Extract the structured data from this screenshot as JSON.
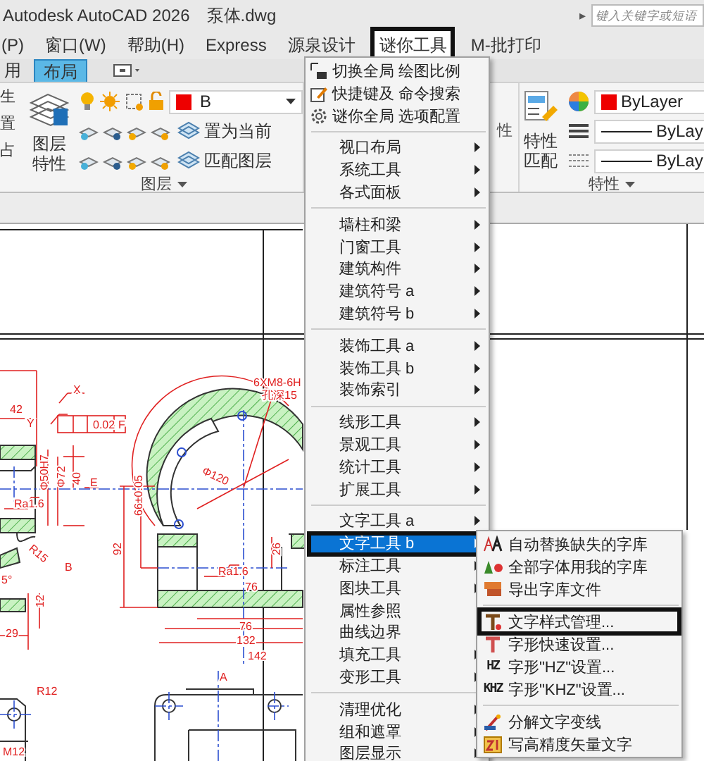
{
  "title_bar": {
    "app": "Autodesk AutoCAD 2026",
    "file": "泵体.dwg",
    "search": {
      "arrow": "▸",
      "placeholder": "键入关键字或短语"
    }
  },
  "menu_bar": [
    {
      "label": "(P)",
      "selected": false,
      "boxed": false
    },
    {
      "label": "窗口(W)",
      "selected": false,
      "boxed": false
    },
    {
      "label": "帮助(H)",
      "selected": false,
      "boxed": false
    },
    {
      "label": "Express",
      "selected": false,
      "boxed": false
    },
    {
      "label": "源泉设计",
      "selected": false,
      "boxed": false
    },
    {
      "label": "谜你工具",
      "selected": true,
      "boxed": true
    },
    {
      "label": "M-批打印",
      "selected": false,
      "boxed": false
    }
  ],
  "tabs": [
    {
      "label": "用",
      "selected": false
    },
    {
      "label": "布局",
      "selected": true
    }
  ],
  "ribbon": {
    "left_column": [
      "生",
      "置",
      "占"
    ],
    "layer_panel": {
      "big_button": "图层特性",
      "layer_name": "B",
      "buttons": [
        "置为当前",
        "匹配图层"
      ],
      "title": "图层"
    },
    "hidden_panel_label": "性",
    "properties_panel": {
      "match_button": "特性匹配",
      "color_setting": "ByLayer",
      "lineweight": "ByLay",
      "linetype": "ByLay",
      "title": "特性"
    }
  },
  "menu": {
    "groups": [
      [
        {
          "label": "切换全局 绘图比例",
          "submenu": false,
          "selected": false,
          "boxed": false
        },
        {
          "label": "快捷键及 命令搜索",
          "submenu": false,
          "selected": false,
          "boxed": false
        },
        {
          "label": "谜你全局 选项配置",
          "submenu": false,
          "selected": false,
          "boxed": false
        }
      ],
      [
        {
          "label": "视口布局",
          "submenu": true,
          "selected": false,
          "boxed": false
        },
        {
          "label": "系统工具",
          "submenu": true,
          "selected": false,
          "boxed": false
        },
        {
          "label": "各式面板",
          "submenu": true,
          "selected": false,
          "boxed": false
        }
      ],
      [
        {
          "label": "墙柱和梁",
          "submenu": true,
          "selected": false,
          "boxed": false
        },
        {
          "label": "门窗工具",
          "submenu": true,
          "selected": false,
          "boxed": false
        },
        {
          "label": "建筑构件",
          "submenu": true,
          "selected": false,
          "boxed": false
        },
        {
          "label": "建筑符号 a",
          "submenu": true,
          "selected": false,
          "boxed": false
        },
        {
          "label": "建筑符号 b",
          "submenu": true,
          "selected": false,
          "boxed": false
        }
      ],
      [
        {
          "label": "装饰工具 a",
          "submenu": true,
          "selected": false,
          "boxed": false
        },
        {
          "label": "装饰工具 b",
          "submenu": true,
          "selected": false,
          "boxed": false
        },
        {
          "label": "装饰索引",
          "submenu": true,
          "selected": false,
          "boxed": false
        }
      ],
      [
        {
          "label": "线形工具",
          "submenu": true,
          "selected": false,
          "boxed": false
        },
        {
          "label": "景观工具",
          "submenu": true,
          "selected": false,
          "boxed": false
        },
        {
          "label": "统计工具",
          "submenu": true,
          "selected": false,
          "boxed": false
        },
        {
          "label": "扩展工具",
          "submenu": true,
          "selected": false,
          "boxed": false
        }
      ],
      [
        {
          "label": "文字工具 a",
          "submenu": true,
          "selected": false,
          "boxed": false
        },
        {
          "label": "文字工具 b",
          "submenu": true,
          "selected": true,
          "boxed": true
        },
        {
          "label": "标注工具",
          "submenu": true,
          "selected": false,
          "boxed": false
        },
        {
          "label": "图块工具",
          "submenu": true,
          "selected": false,
          "boxed": false
        },
        {
          "label": "属性参照",
          "submenu": false,
          "selected": false,
          "boxed": false
        },
        {
          "label": "曲线边界",
          "submenu": false,
          "selected": false,
          "boxed": false
        },
        {
          "label": "填充工具",
          "submenu": true,
          "selected": false,
          "boxed": false
        },
        {
          "label": "变形工具",
          "submenu": true,
          "selected": false,
          "boxed": false
        }
      ],
      [
        {
          "label": "清理优化",
          "submenu": true,
          "selected": false,
          "boxed": false
        },
        {
          "label": "组和遮罩",
          "submenu": true,
          "selected": false,
          "boxed": false
        },
        {
          "label": "图层显示",
          "submenu": true,
          "selected": false,
          "boxed": false
        }
      ]
    ]
  },
  "submenu": {
    "groups": [
      [
        {
          "label": "自动替换缺失的字库",
          "boxed": false
        },
        {
          "label": "全部字体用我的字库",
          "boxed": false
        },
        {
          "label": "导出字库文件",
          "boxed": false
        }
      ],
      [
        {
          "label": "文字样式管理...",
          "boxed": true
        },
        {
          "label": "字形快速设置...",
          "boxed": false
        },
        {
          "label": "字形\"HZ\"设置...",
          "icon_text": "HZ",
          "boxed": false
        },
        {
          "label": "字形\"KHZ\"设置...",
          "icon_text": "KHZ",
          "boxed": false
        }
      ],
      [
        {
          "label": "分解文字变线",
          "boxed": false
        },
        {
          "label": "写高精度矢量文字",
          "boxed": false
        }
      ]
    ]
  },
  "drawing": {
    "labels": [
      "X",
      "42",
      "Y",
      "0.02",
      "F",
      "Φ50H7",
      "Φ72",
      "40",
      "E",
      "Ra1.6",
      "R15",
      "B",
      "5°",
      "12",
      "29",
      "6XM8-6H",
      "孔深15",
      "Φ120",
      "66±0.05",
      "92",
      "26",
      "Ra1.6",
      "76",
      "76",
      "132",
      "142",
      "A",
      "R12",
      "M12"
    ]
  }
}
